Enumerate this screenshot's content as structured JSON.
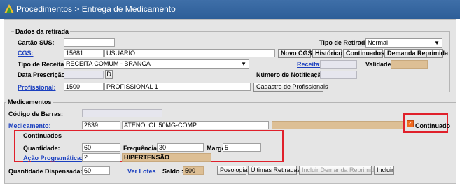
{
  "title": "Procedimentos > Entrega de Medicamento",
  "retirada": {
    "legend": "Dados da retirada",
    "cartao_sus_label": "Cartão SUS:",
    "cartao_sus_value": "",
    "tipo_retirada_label": "Tipo de Retirada:",
    "tipo_retirada_value": "Normal",
    "cgs_label": "CGS:",
    "cgs_code": "15681",
    "cgs_name": "USUÁRIO",
    "buttons": {
      "novo_cgs": "Novo CGS",
      "historico": "Histórico",
      "continuados": "Continuados",
      "demanda": "Demanda Reprimida"
    },
    "tipo_receita_label": "Tipo de Receita:",
    "tipo_receita_value": "RECEITA COMUM - BRANCA",
    "receita_label": "Receita:",
    "receita_value": "",
    "validade_label": "Validade:",
    "validade_value": "",
    "data_prescricao_label": "Data Prescrição:",
    "data_prescricao_value": "",
    "d_button": "D",
    "notificacao_label": "Número de Notificação:",
    "notificacao_value": "",
    "profissional_label": "Profissional:",
    "profissional_code": "1500",
    "profissional_name": "PROFISSIONAL 1",
    "cadastro_button": "Cadastro de Profissionais"
  },
  "medicamentos": {
    "legend": "Medicamentos",
    "codigo_barras_label": "Código de Barras:",
    "codigo_barras_value": "",
    "medicamento_label": "Medicamento:",
    "medicamento_code": "2839",
    "medicamento_name": "ATENOLOL 50MG-COMP",
    "medicamento_extra": "",
    "continuado_label": "Continuado",
    "continuado_checked": true,
    "continuados": {
      "legend": "Continuados",
      "quantidade_label": "Quantidade:",
      "quantidade_value": "60",
      "frequencia_label": "Frequência:",
      "frequencia_value": "30",
      "margem_label": "Margem:",
      "margem_value": "5",
      "acao_label": "Ação Programática:",
      "acao_code": "2",
      "acao_name": "HIPERTENSÃO"
    },
    "qtd_dispensada_label": "Quantidade Dispensada:",
    "qtd_dispensada_value": "60",
    "ver_lotes": "Ver Lotes",
    "saldo_label": "Saldo :",
    "saldo_value": "500",
    "posologia_button": "Posologia",
    "ultimas_button": "Últimas Retiradas",
    "incluir_demanda_button": "Incluir Demanda Reprimida",
    "incluir_button": "Incluir"
  },
  "colors": {
    "titlebar": "#2d5e98",
    "link": "#1a3fbf",
    "highlight_red": "#e0202b",
    "readonly_tan": "#ddbf95"
  }
}
